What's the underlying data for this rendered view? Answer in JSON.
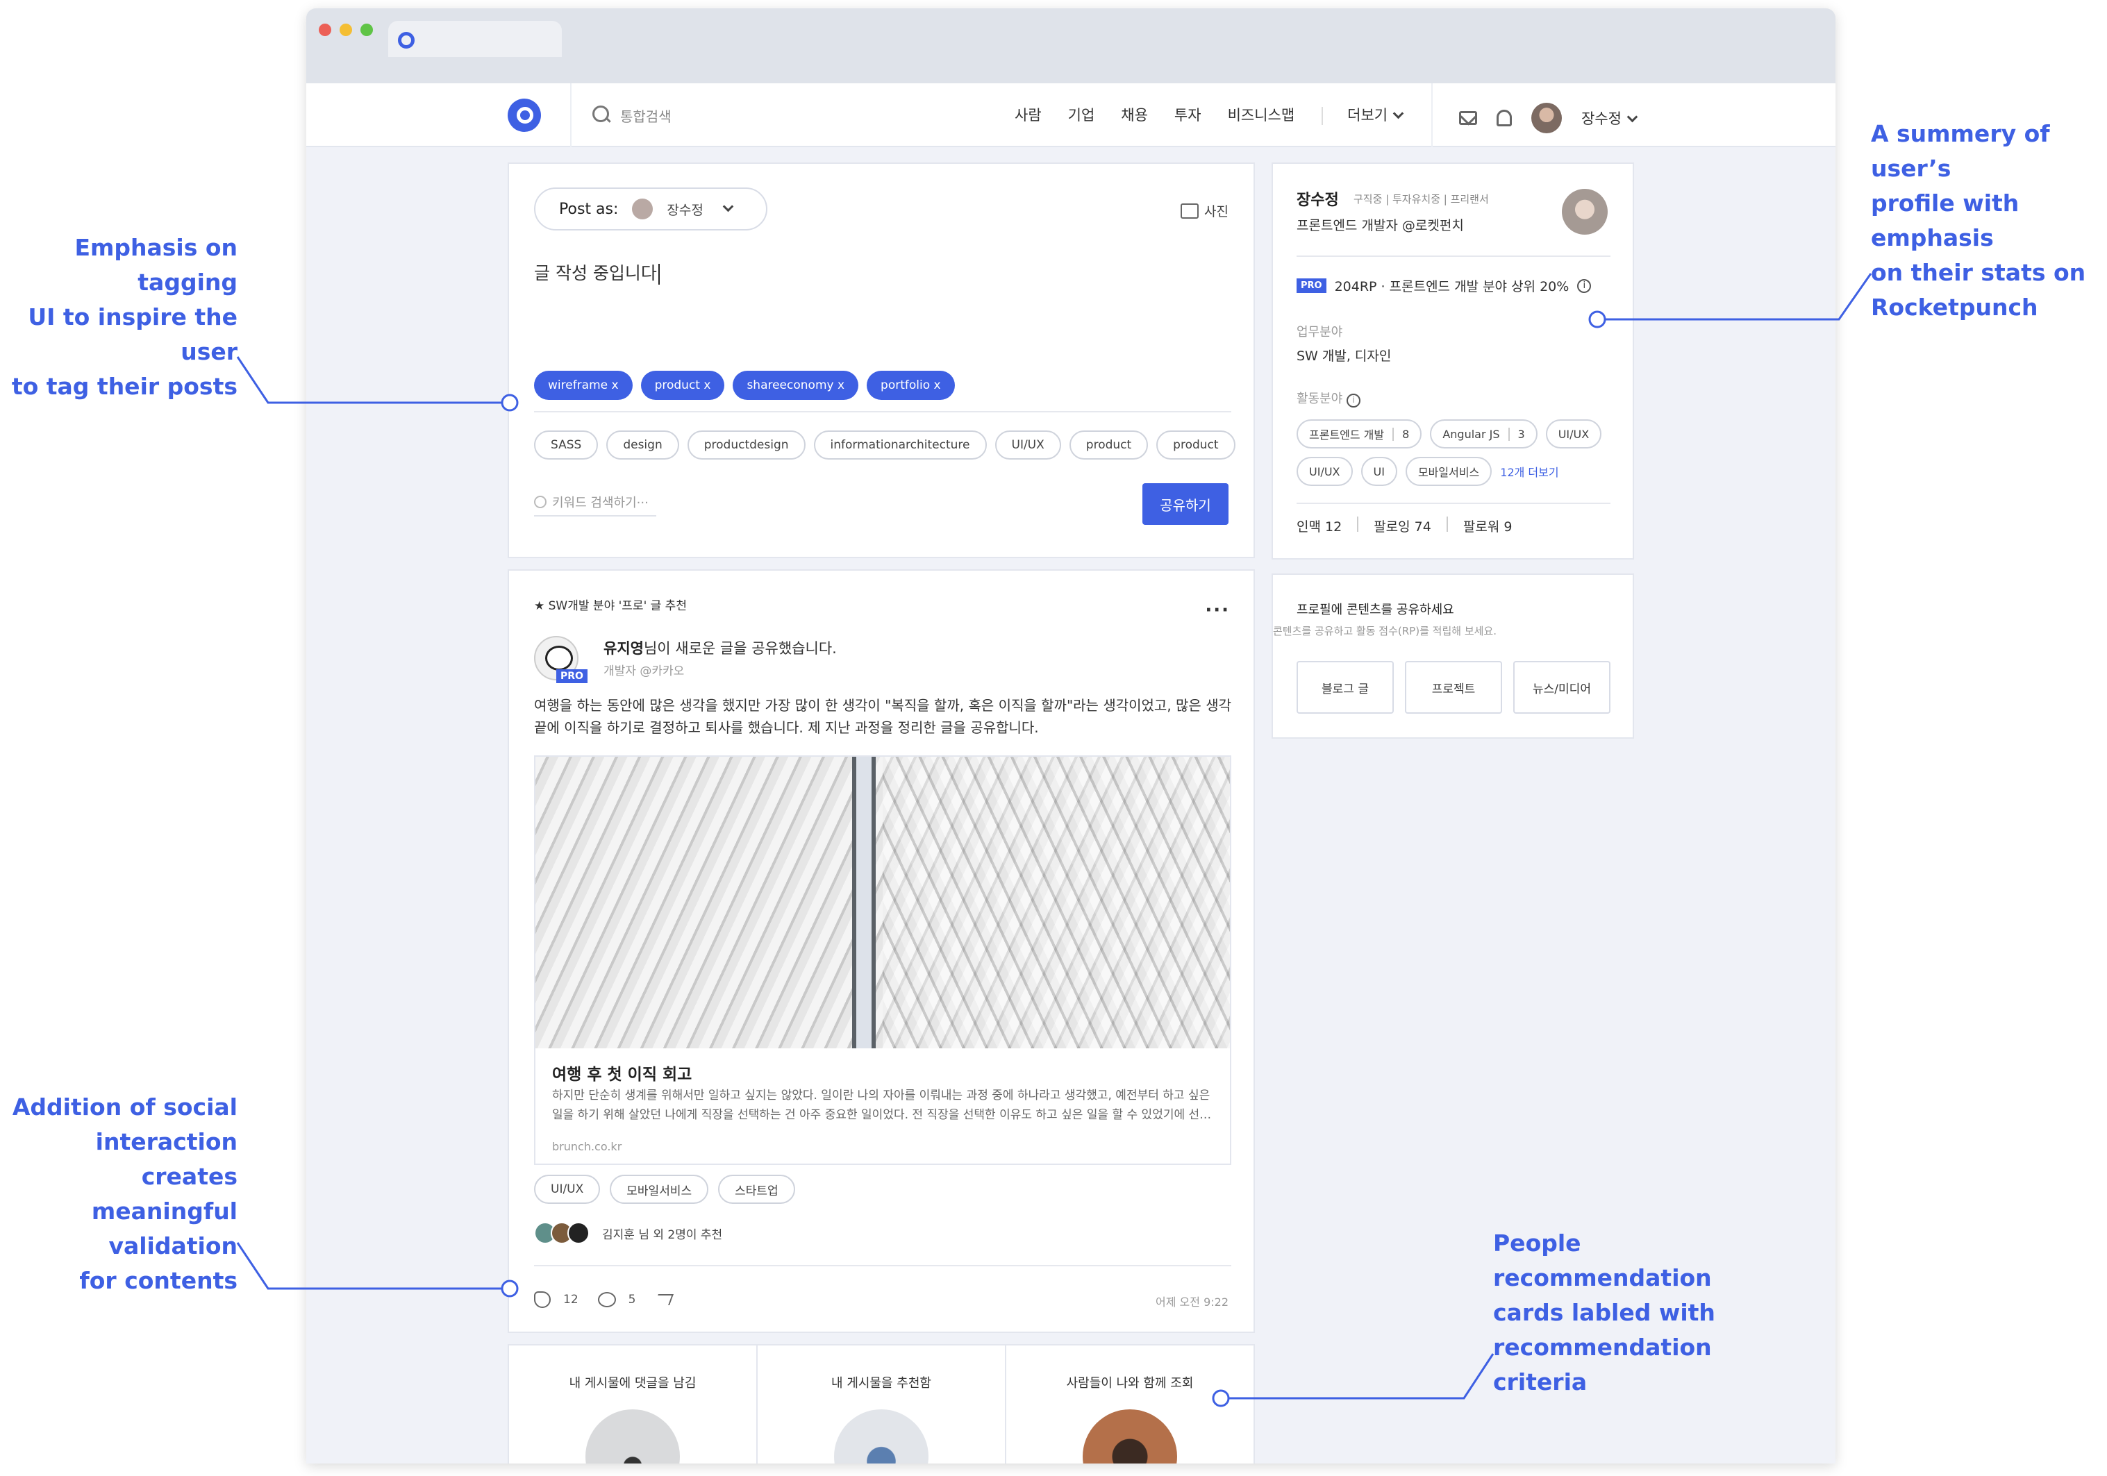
{
  "header": {
    "search_placeholder": "통합검색",
    "nav": [
      "사람",
      "기업",
      "채용",
      "투자",
      "비즈니스맵"
    ],
    "more": "더보기",
    "user": "장수정"
  },
  "composer": {
    "post_as_label": "Post as:",
    "post_as_user": "장수정",
    "photo_label": "사진",
    "draft_text": "글 작성 중입니다",
    "selected_tags": [
      "wireframe x",
      "product x",
      "shareeconomy x",
      "portfolio x"
    ],
    "suggested_tags": [
      "SASS",
      "design",
      "productdesign",
      "informationarchitecture",
      "UI/UX",
      "product",
      "product"
    ],
    "keyword_placeholder": "키워드 검색하기···",
    "share_label": "공유하기"
  },
  "post": {
    "recommend_label": "★ SW개발 분야 '프로' 글 추천",
    "menu": "···",
    "pro_badge": "PRO",
    "author_name": "유지영",
    "author_action": "님이 새로운 글을 공유했습니다.",
    "author_sub": "개발자 @카카오",
    "body": "여행을 하는 동안에 많은 생각을 했지만 가장 많이 한 생각이 \"복직을 할까, 혹은 이직을 할까\"라는 생각이었고, 많은 생각 끝에 이직을 하기로 결정하고 퇴사를 했습니다. 제 지난 과정을 정리한 글을 공유합니다.",
    "link_title": "여행 후 첫 이직 회고",
    "link_desc": "하지만 단순히 생계를 위해서만 일하고 싶지는 않았다. 일이란 나의 자아를 이뤄내는 과정 중에 하나라고 생각했고, 예전부터 하고 싶은 일을 하기 위해 살았던 나에게 직장을 선택하는 건 아주 중요한 일이었다. 전 직장을 선택한 이유도 하고 싶은 일을 할 수 있었기에 선…",
    "link_domain": "brunch.co.kr",
    "tags": [
      "UI/UX",
      "모바일서비스",
      "스타트업"
    ],
    "recommenders_text": "김지훈 님 외 2명이 추천",
    "claps": "12",
    "comments": "5",
    "time": "어제 오전 9:22"
  },
  "people": [
    {
      "label": "내 게시물에 댓글을 남김"
    },
    {
      "label": "내 게시물을 추천함"
    },
    {
      "label": "사람들이 나와 함께 조회"
    }
  ],
  "profile": {
    "name": "장수정",
    "status": "구직중 | 투자유치중 | 프리랜서",
    "title": "프론트엔드 개발자 @로켓펀치",
    "pro_badge": "PRO",
    "rank_text": "204RP · 프론트엔드 개발 분야 상위 20%",
    "work_label": "업무분야",
    "work_value": "SW 개발, 디자인",
    "activity_label": "활동분야",
    "skills": [
      {
        "name": "프론트엔드 개발",
        "count": "8"
      },
      {
        "name": "Angular JS",
        "count": "3"
      },
      {
        "name": "UI/UX",
        "count": ""
      },
      {
        "name": "UI/UX",
        "count": ""
      },
      {
        "name": "UI",
        "count": ""
      },
      {
        "name": "모바일서비스",
        "count": ""
      }
    ],
    "more_skills": "12개 더보기",
    "connections": "인맥 12",
    "following": "팔로잉 74",
    "followers": "팔로워 9"
  },
  "share_card": {
    "title": "프로필에 콘텐츠를 공유하세요",
    "subtitle": "콘텐츠를 공유하고 활동 점수(RP)를 적립해 보세요.",
    "buttons": [
      "블로그 글",
      "프로젝트",
      "뉴스/미디어"
    ]
  },
  "annotations": {
    "tagging": [
      "Emphasis on tagging",
      "UI to inspire the user",
      "to tag their posts"
    ],
    "profile": [
      "A summery of user’s",
      "profile with emphasis",
      "on their stats on",
      "Rocketpunch"
    ],
    "social": [
      "Addition of social",
      "interaction creates",
      "meaningful validation",
      "for contents"
    ],
    "people": [
      "People recommendation",
      "cards labled with",
      "recommendation criteria"
    ]
  },
  "colors": {
    "accent": "#3e60e3",
    "background": "#f0f2f8"
  }
}
